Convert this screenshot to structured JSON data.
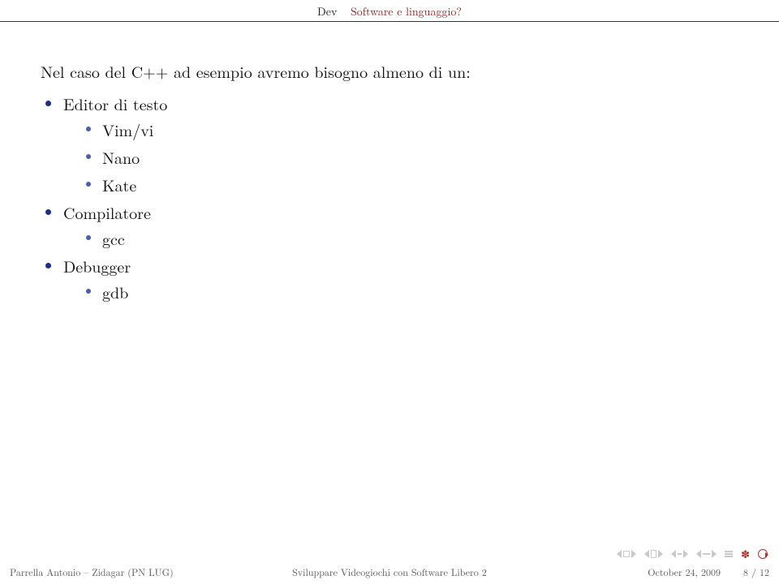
{
  "header": {
    "section": "Dev",
    "subsection": "Software e linguaggio?"
  },
  "content": {
    "intro": "Nel caso del C++ ad esempio avremo bisogno almeno di un:",
    "items": [
      {
        "label": "Editor di testo",
        "children": [
          "Vim/vi",
          "Nano",
          "Kate"
        ]
      },
      {
        "label": "Compilatore",
        "children": [
          "gcc"
        ]
      },
      {
        "label": "Debugger",
        "children": [
          "gdb"
        ]
      }
    ]
  },
  "footer": {
    "author": "Parrella Antonio – Zidagar (PN LUG)",
    "title": "Sviluppare Videogiochi con Software Libero 2",
    "date": "October 24, 2009",
    "page": "8 / 12"
  }
}
